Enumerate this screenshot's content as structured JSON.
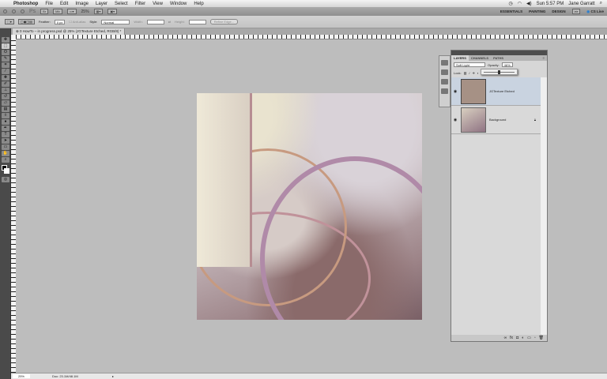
{
  "menubar": {
    "app": "Photoshop",
    "items": [
      "File",
      "Edit",
      "Image",
      "Layer",
      "Select",
      "Filter",
      "View",
      "Window",
      "Help"
    ],
    "clock": "Sun 5:57 PM",
    "user": "Jane Garratt"
  },
  "appbar": {
    "ps": "Ps",
    "br": "Br",
    "mb": "Mb",
    "zoom": "25%",
    "workspaces": [
      "ESSENTIALS",
      "PAINTING",
      "DESIGN"
    ],
    "more": ">>",
    "cslive": "CS Live"
  },
  "options": {
    "feather_label": "Feather:",
    "feather_value": "0 px",
    "antialias": "Anti-alias",
    "style_label": "Style:",
    "style_value": "Normal",
    "width_label": "Width:",
    "height_label": "Height:",
    "refine": "Refine Edge..."
  },
  "doc_tab": "0 HowTo – in progress.psd @ 25% (JGTexture Etched, RGB/8) *",
  "panel": {
    "tabs": [
      "LAYERS",
      "CHANNELS",
      "PATHS"
    ],
    "blend_mode": "Soft Light",
    "opacity_label": "Opacity:",
    "opacity_value": "46%",
    "opacity": 46,
    "lock_label": "Lock:",
    "layers": [
      {
        "name": "JGTexture Etched",
        "selected": true
      },
      {
        "name": "Background",
        "locked": true
      }
    ]
  },
  "status": {
    "zoom": "25%",
    "doc": "Doc: 23.1M/48.1M"
  }
}
